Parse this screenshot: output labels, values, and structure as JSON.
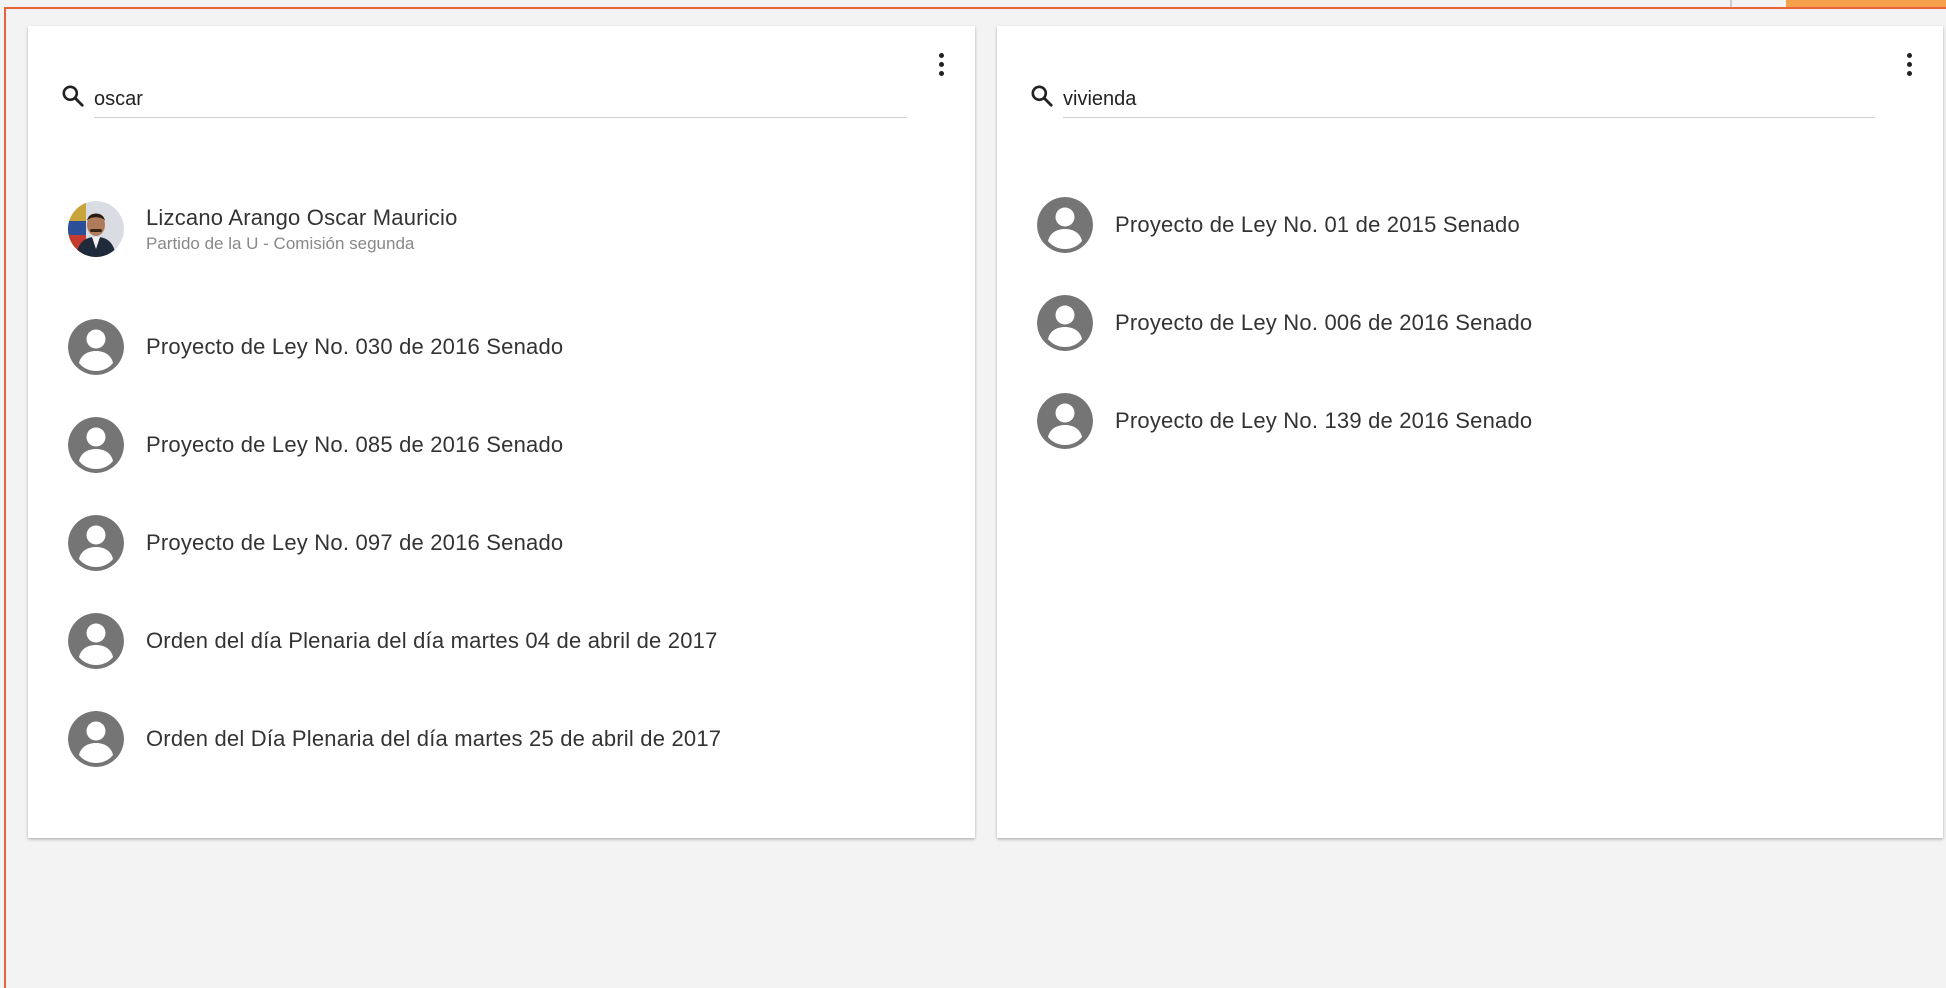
{
  "left_panel": {
    "search_value": "oscar",
    "person": {
      "name": "Lizcano Arango Oscar Mauricio",
      "detail": "Partido de la U - Comisión segunda"
    },
    "results": [
      "Proyecto de Ley No. 030 de 2016 Senado",
      "Proyecto de Ley No. 085 de 2016 Senado",
      "Proyecto de Ley No. 097 de 2016 Senado",
      "Orden del día Plenaria del día martes 04 de abril de 2017",
      "Orden del Día Plenaria del día martes 25 de abril de 2017"
    ]
  },
  "right_panel": {
    "search_value": "vivienda",
    "results": [
      "Proyecto de Ley No. 01 de 2015 Senado",
      "Proyecto de Ley No. 006 de 2016 Senado",
      "Proyecto de Ley No. 139 de 2016 Senado"
    ]
  },
  "icons": {
    "search": "search-icon",
    "more": "more-vert-icon",
    "default_avatar": "account-circle-icon"
  },
  "colors": {
    "accent": "#e8643a",
    "avatar_grey": "#757575",
    "tab_orange": "#f5a04a"
  }
}
